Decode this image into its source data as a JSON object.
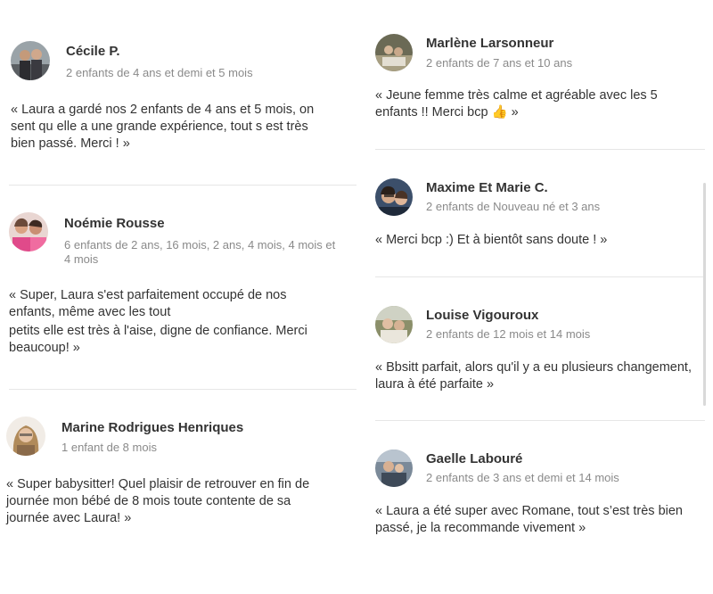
{
  "reviews": [
    {
      "name": "Cécile P.",
      "meta": "2 enfants de 4 ans et demi et 5 mois",
      "text": "« Laura a gardé nos 2 enfants de 4 ans et 5 mois, on sent qu elle a une grande expérience, tout s est très bien passé. Merci ! »"
    },
    {
      "name": "Noémie Rousse",
      "meta": "6 enfants de 2 ans, 16 mois, 2 ans, 4 mois, 4 mois et 4 mois",
      "text_line1": "« Super, Laura s'est parfaitement occupé de nos enfants, même avec les tout",
      "text_line2": "petits elle est très à l'aise, digne de confiance. Merci beaucoup! »"
    },
    {
      "name": "Marine Rodrigues Henriques",
      "meta": "1 enfant de 8 mois",
      "text": "« Super babysitter! Quel plaisir de retrouver en fin de journée mon bébé de 8 mois toute contente de sa journée avec Laura! »"
    },
    {
      "name": "Marlène Larsonneur",
      "meta": "2 enfants de 7 ans et 10 ans",
      "text": "« Jeune femme très calme et agréable avec les 5 enfants !! Merci bcp 👍 »"
    },
    {
      "name": "Maxime Et Marie C.",
      "meta": "2 enfants de Nouveau né et 3 ans",
      "text": "« Merci bcp :) Et à bientôt sans doute ! »"
    },
    {
      "name": "Louise Vigouroux",
      "meta": "2 enfants de 12 mois et 14 mois",
      "text": "« Bbsitt parfait, alors qu'il y a eu plusieurs changement, laura à été parfaite »"
    },
    {
      "name": "Gaelle Labouré",
      "meta": "2 enfants de 3 ans et demi et 14 mois",
      "text": "« Laura a été super avec Romane, tout s’est très bien passé, je la recommande vivement »"
    }
  ]
}
